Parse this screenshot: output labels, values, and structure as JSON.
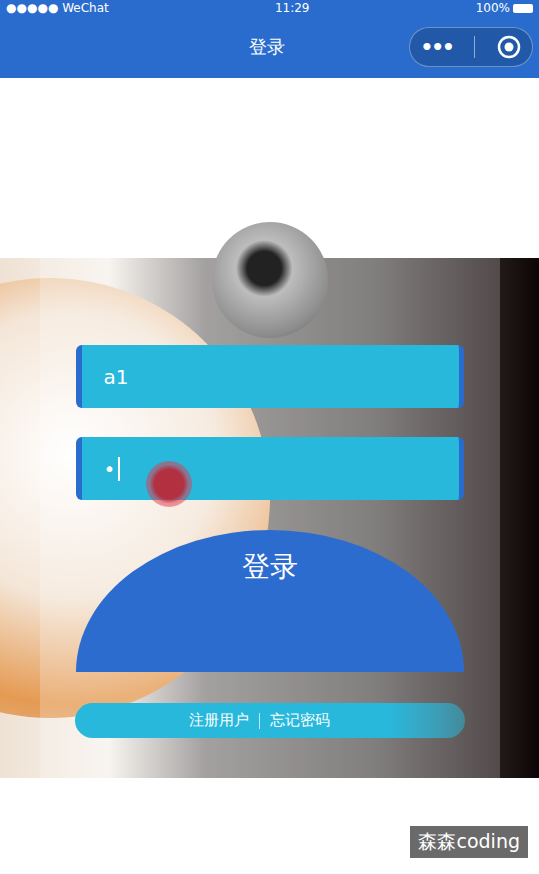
{
  "status_bar": {
    "carrier": "●●●●● WeChat",
    "time": "11:29",
    "battery": "100%"
  },
  "nav_bar": {
    "title": "登录",
    "more": "•••"
  },
  "form": {
    "username": "a1",
    "password": "•",
    "password_focused": true
  },
  "login_button": "登录",
  "links": [
    "注册用户",
    "忘记密码"
  ],
  "watermark": "森森coding"
}
